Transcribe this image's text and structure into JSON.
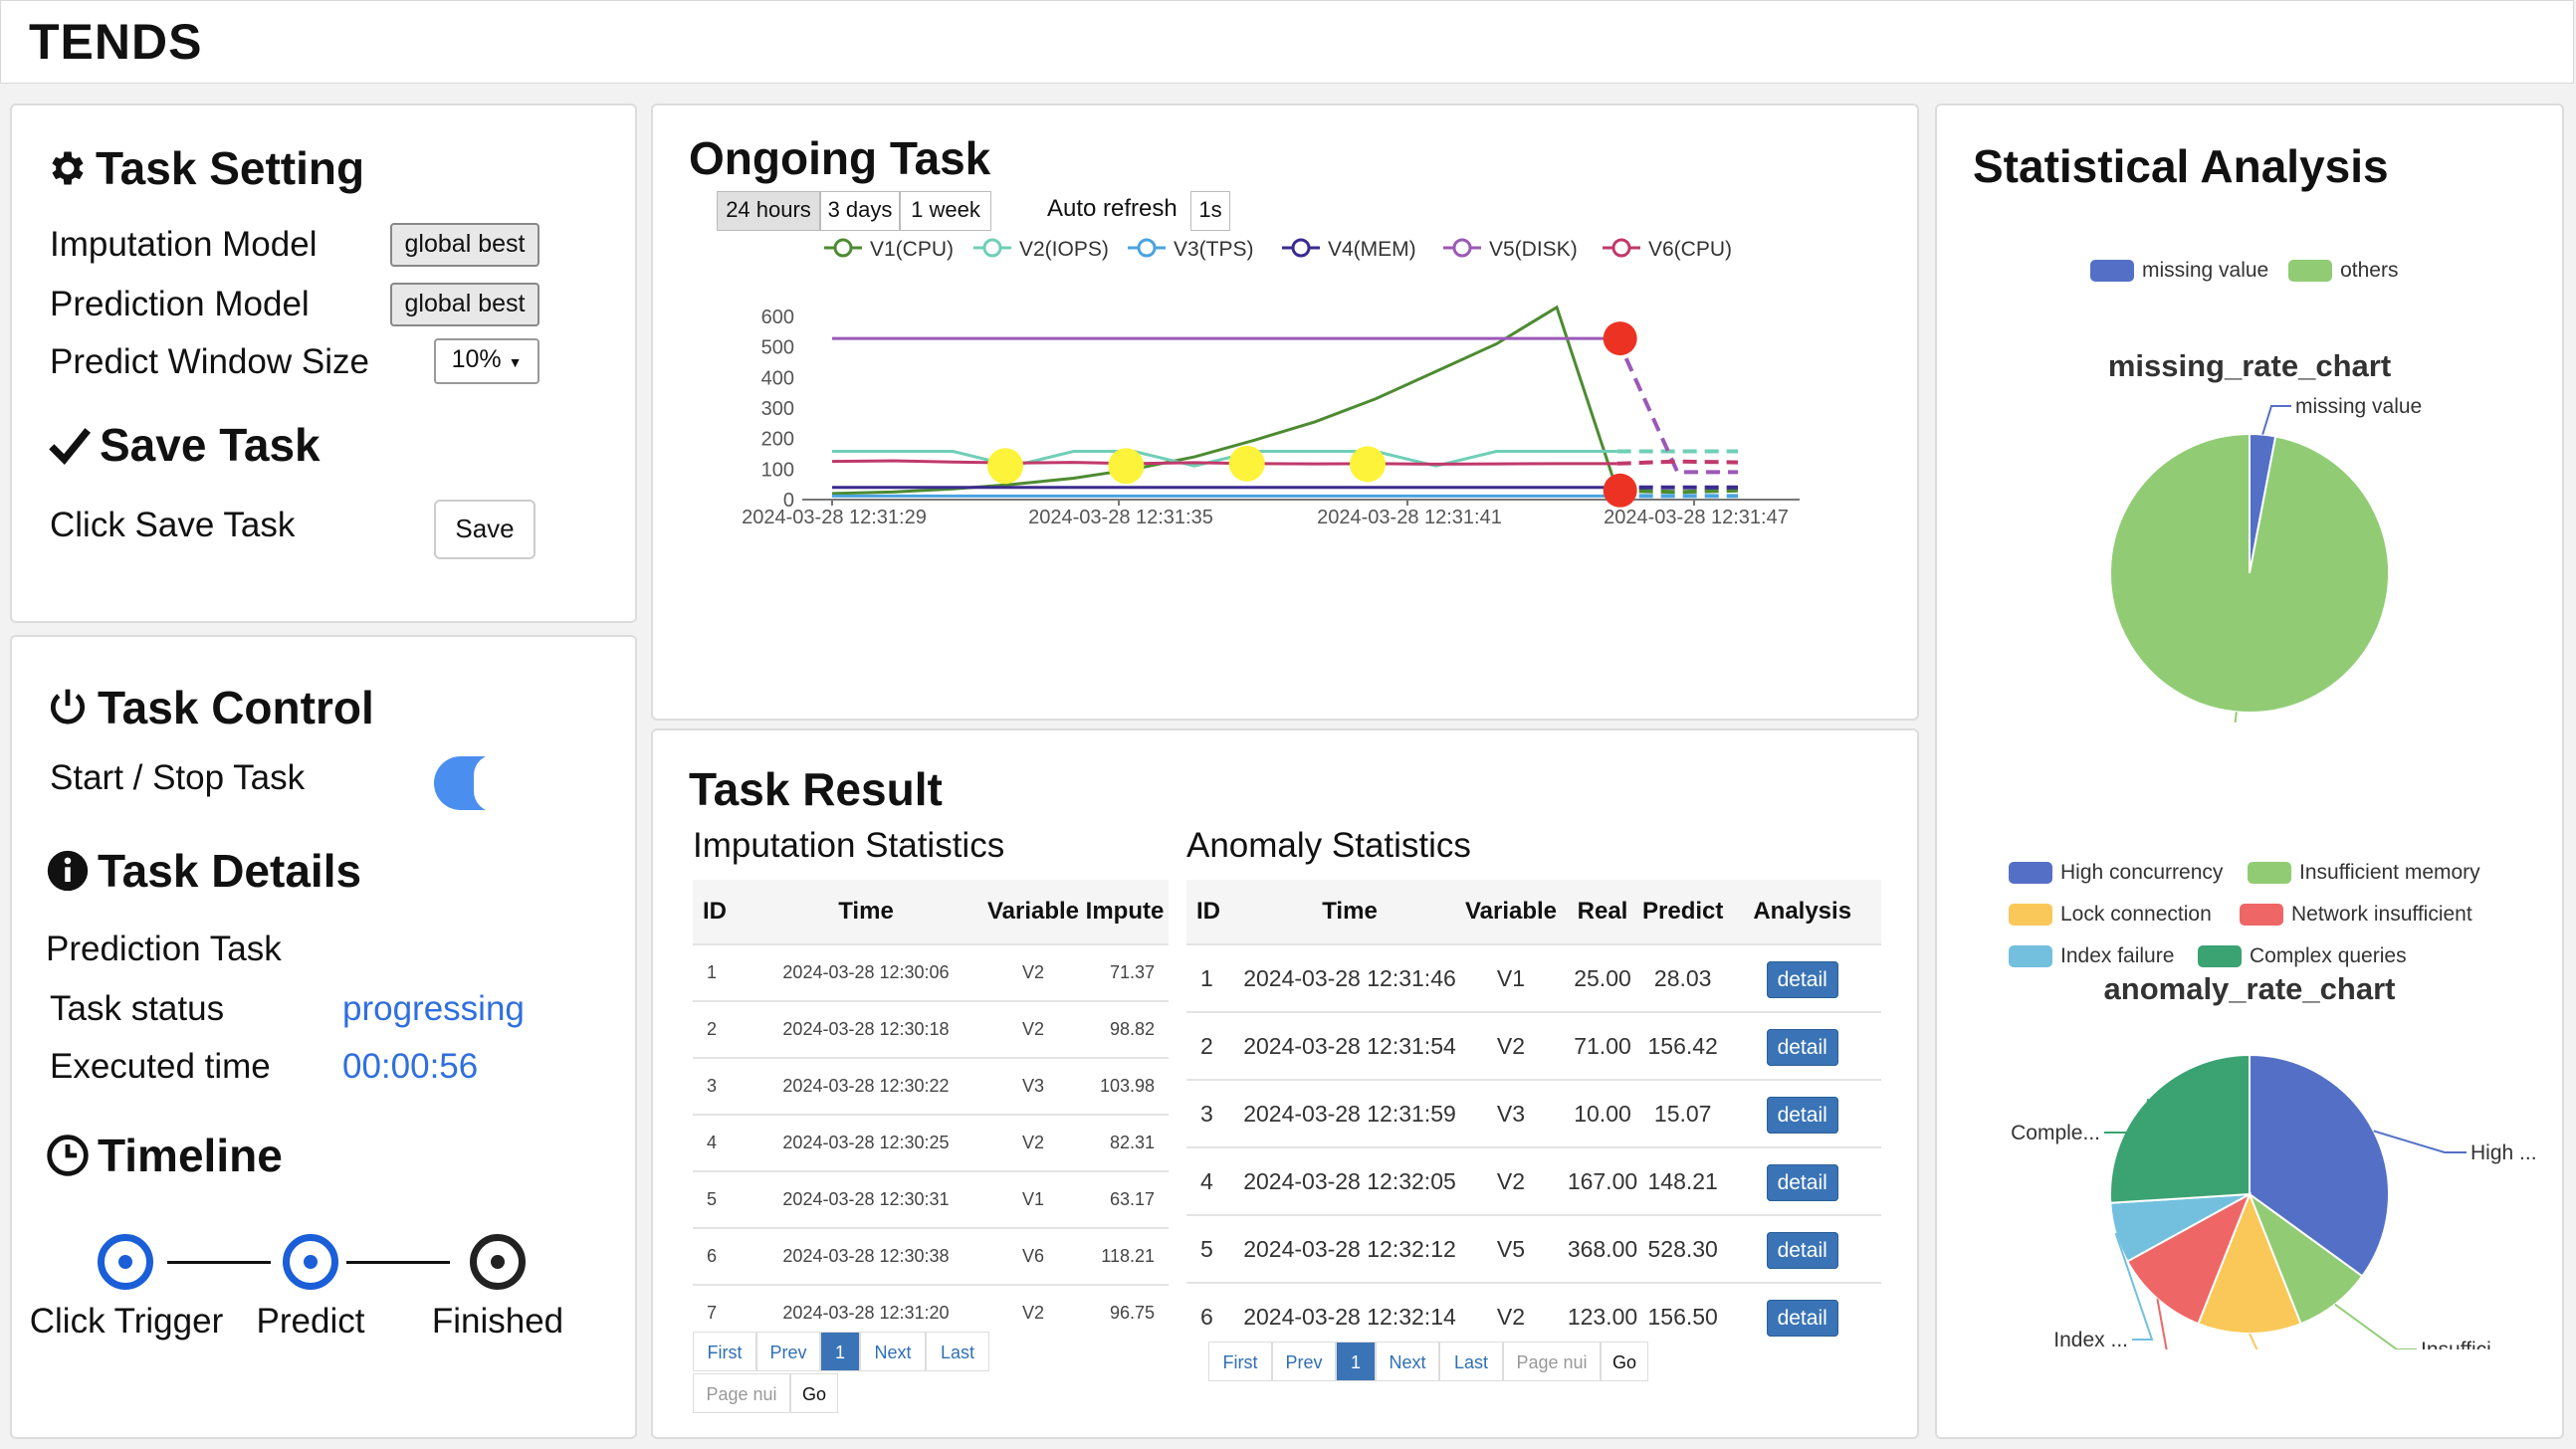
{
  "app": {
    "title": "TENDS"
  },
  "task_setting": {
    "title": "Task Setting",
    "imputation_label": "Imputation Model",
    "imputation_value": "global best",
    "prediction_label": "Prediction Model",
    "prediction_value": "global best",
    "window_label": "Predict Window Size",
    "window_value": "10%",
    "save_title": "Save Task",
    "save_hint": "Click Save Task",
    "save_button": "Save"
  },
  "task_control": {
    "title": "Task Control",
    "toggle_label": "Start / Stop Task",
    "toggle_on": true,
    "details_title": "Task Details",
    "task_name": "Prediction Task",
    "status_label": "Task status",
    "status_value": "progressing",
    "time_label": "Executed time",
    "time_value": "00:00:56",
    "timeline_title": "Timeline",
    "steps": [
      "Click Trigger",
      "Predict",
      "Finished"
    ]
  },
  "ongoing": {
    "title": "Ongoing Task",
    "ranges": [
      "24 hours",
      "3 days",
      "1 week"
    ],
    "active_range": "24 hours",
    "auto_refresh_label": "Auto refresh",
    "auto_refresh_value": "1s"
  },
  "chart_data": {
    "type": "line",
    "title": "",
    "x": [
      "2024-03-28 12:31:29",
      "2024-03-28 12:31:35",
      "2024-03-28 12:31:41",
      "2024-03-28 12:31:47"
    ],
    "ylim": [
      0,
      600
    ],
    "yticks": [
      "600",
      "500",
      "400",
      "300",
      "200",
      "100",
      "0"
    ],
    "series": [
      {
        "name": "V1(CPU)",
        "color": "#4d8b31",
        "values": [
          20,
          25,
          35,
          50,
          70,
          100,
          140,
          195,
          255,
          330,
          420,
          510,
          630,
          30,
          25,
          30
        ]
      },
      {
        "name": "V2(IOPS)",
        "color": "#6fcfb7",
        "values": [
          158,
          158,
          158,
          110,
          158,
          158,
          110,
          158,
          158,
          158,
          110,
          158,
          158,
          158,
          158,
          158
        ]
      },
      {
        "name": "V3(TPS)",
        "color": "#4aa3df",
        "values": [
          12,
          12,
          12,
          12,
          12,
          12,
          12,
          12,
          12,
          12,
          12,
          12,
          12,
          12,
          12,
          12
        ]
      },
      {
        "name": "V4(MEM)",
        "color": "#3b2b8f",
        "values": [
          40,
          40,
          40,
          40,
          40,
          40,
          40,
          40,
          40,
          40,
          40,
          40,
          40,
          40,
          40,
          40
        ]
      },
      {
        "name": "V5(DISK)",
        "color": "#9b59b6",
        "values": [
          528,
          528,
          528,
          528,
          528,
          528,
          528,
          528,
          528,
          528,
          528,
          528,
          528,
          528,
          90,
          90
        ]
      },
      {
        "name": "V6(CPU)",
        "color": "#c0396b",
        "values": [
          125,
          127,
          123,
          120,
          122,
          118,
          121,
          118,
          117,
          118,
          116,
          117,
          118,
          118,
          125,
          122
        ]
      }
    ],
    "legend": "top"
  },
  "task_result": {
    "title": "Task Result",
    "imputation": {
      "title": "Imputation Statistics",
      "headers": [
        "ID",
        "Time",
        "Variable",
        "Impute"
      ],
      "rows": [
        [
          "1",
          "2024-03-28 12:30:06",
          "V2",
          "71.37"
        ],
        [
          "2",
          "2024-03-28 12:30:18",
          "V2",
          "98.82"
        ],
        [
          "3",
          "2024-03-28 12:30:22",
          "V3",
          "103.98"
        ],
        [
          "4",
          "2024-03-28 12:30:25",
          "V2",
          "82.31"
        ],
        [
          "5",
          "2024-03-28 12:30:31",
          "V1",
          "63.17"
        ],
        [
          "6",
          "2024-03-28 12:30:38",
          "V6",
          "118.21"
        ],
        [
          "7",
          "2024-03-28 12:31:20",
          "V2",
          "96.75"
        ]
      ]
    },
    "anomaly": {
      "title": "Anomaly Statistics",
      "headers": [
        "ID",
        "Time",
        "Variable",
        "Real",
        "Predict",
        "Analysis"
      ],
      "detail_label": "detail",
      "rows": [
        [
          "1",
          "2024-03-28 12:31:46",
          "V1",
          "25.00",
          "28.03"
        ],
        [
          "2",
          "2024-03-28 12:31:54",
          "V2",
          "71.00",
          "156.42"
        ],
        [
          "3",
          "2024-03-28 12:31:59",
          "V3",
          "10.00",
          "15.07"
        ],
        [
          "4",
          "2024-03-28 12:32:05",
          "V2",
          "167.00",
          "148.21"
        ],
        [
          "5",
          "2024-03-28 12:32:12",
          "V5",
          "368.00",
          "528.30"
        ],
        [
          "6",
          "2024-03-28 12:32:14",
          "V2",
          "123.00",
          "156.50"
        ]
      ]
    },
    "pager": {
      "first": "First",
      "prev": "Prev",
      "page": "1",
      "next": "Next",
      "last": "Last",
      "page_placeholder": "Page nui",
      "go": "Go"
    }
  },
  "statistical": {
    "title": "Statistical Analysis",
    "missing": {
      "title": "missing_rate_chart",
      "legend": [
        {
          "name": "missing value",
          "color": "#5470c6"
        },
        {
          "name": "others",
          "color": "#91cc75"
        }
      ],
      "values": [
        3,
        97
      ],
      "labels": [
        "missing value",
        "others"
      ]
    },
    "anomaly": {
      "title": "anomaly_rate_chart",
      "legend": [
        {
          "name": "High concurrency",
          "color": "#5470c6"
        },
        {
          "name": "Insufficient memory",
          "color": "#91cc75"
        },
        {
          "name": "Lock connection",
          "color": "#fac858"
        },
        {
          "name": "Network insufficient",
          "color": "#ee6666"
        },
        {
          "name": "Index failure",
          "color": "#73c0de"
        },
        {
          "name": "Complex queries",
          "color": "#3ba272"
        }
      ],
      "values": [
        35,
        9,
        12,
        11,
        7,
        26
      ],
      "labels": [
        "High ...",
        "Insuffici...",
        "Lock connection",
        "Network in...",
        "Index ...",
        "Comple..."
      ]
    }
  }
}
